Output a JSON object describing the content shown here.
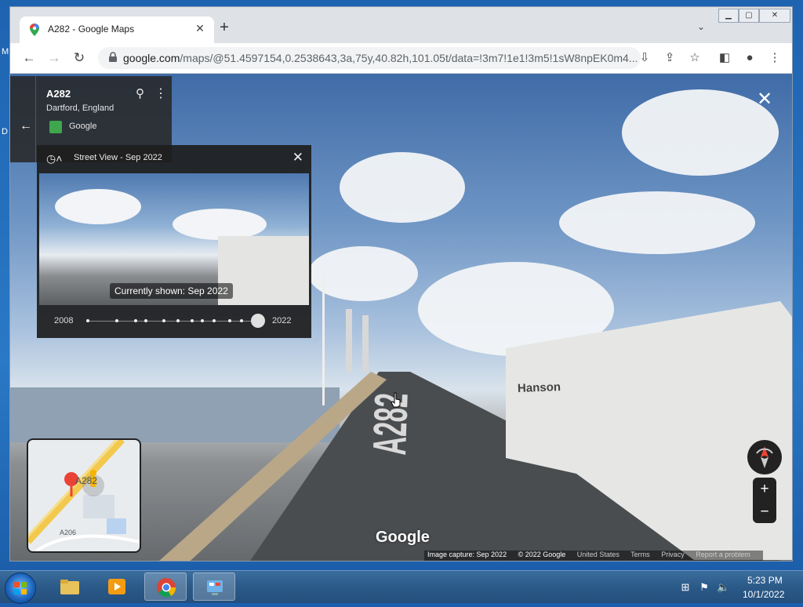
{
  "window": {
    "tab_title": "A282 - Google Maps",
    "url_main": "google.com",
    "url_rest": "/maps/@51.4597154,0.2538643,3a,75y,40.82h,101.05t/data=!3m7!1e1!3m5!1sW8npEK0m4..."
  },
  "place": {
    "name": "A282",
    "location": "Dartford, England",
    "source": "Google"
  },
  "time_machine": {
    "title": "Street View - Sep 2022",
    "caption": "Currently shown: Sep 2022",
    "start_year": "2008",
    "end_year": "2022"
  },
  "minimap": {
    "label_road": "A282",
    "label_road2": "A206"
  },
  "street": {
    "road_marking": "A282",
    "truck_brand": "Hanson",
    "watermark": "Google"
  },
  "footer": {
    "capture": "Image capture: Sep 2022",
    "copyright": "© 2022 Google",
    "country": "United States",
    "terms": "Terms",
    "privacy": "Privacy",
    "report": "Report a problem"
  },
  "taskbar": {
    "time": "5:23 PM",
    "date": "10/1/2022"
  },
  "desktop": {
    "left_letters": [
      "M",
      "D"
    ]
  }
}
